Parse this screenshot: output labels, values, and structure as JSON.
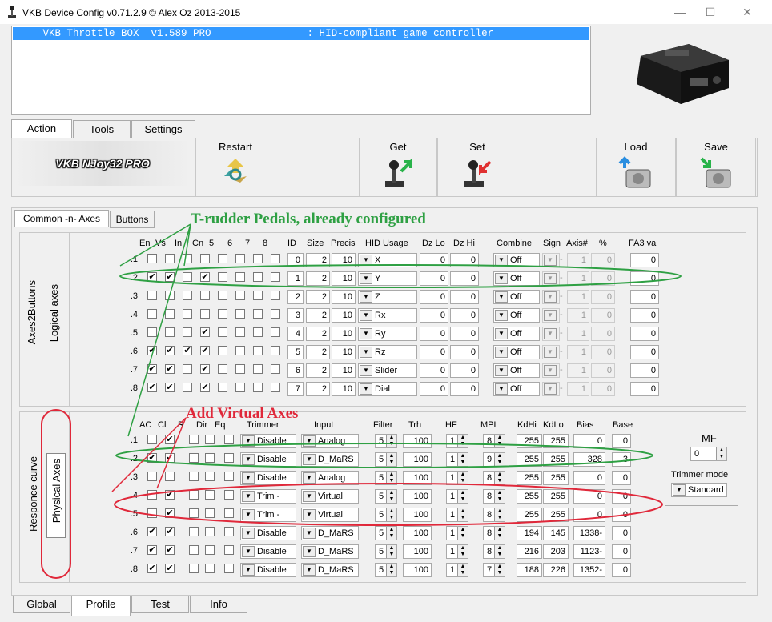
{
  "window": {
    "title": "VKB Device Config v0.71.2.9 © Alex Oz 2013-2015",
    "minimize": "—",
    "maximize": "☐",
    "close": "✕"
  },
  "device_list": {
    "row": "     VKB Throttle BOX  v1.589 PRO                : HID-compliant game controller"
  },
  "main_tabs": [
    "Action",
    "Tools",
    "Settings"
  ],
  "toolbar": {
    "brand": "VKB NJoy32 PRO",
    "restart": "Restart",
    "get": "Get",
    "set": "Set",
    "load": "Load",
    "save": "Save"
  },
  "sub_tabs": [
    "Common -n- Axes",
    "Buttons"
  ],
  "upper": {
    "side_outer": "Axes2Buttons",
    "side_inner": "Logical axes",
    "headers": [
      "En",
      "Vs",
      "In",
      "Cn",
      "5",
      "6",
      "7",
      "8",
      "ID",
      "Size",
      "Precis",
      "HID Usage",
      "Dz Lo",
      "Dz Hi",
      "Combine",
      "Sign",
      "Axis#",
      "%",
      "FA3 val"
    ],
    "rows": [
      {
        "n": ".1",
        "checks": [
          0,
          0,
          0,
          0,
          0,
          0,
          0,
          0
        ],
        "id": "0",
        "size": "2",
        "precis": "10",
        "hid": "X",
        "dzlo": "0",
        "dzhi": "0",
        "combine": "Off",
        "sign": "-",
        "axis": "1",
        "pct": "0",
        "fa3": "0"
      },
      {
        "n": ".2",
        "checks": [
          1,
          1,
          0,
          1,
          0,
          0,
          0,
          0
        ],
        "id": "1",
        "size": "2",
        "precis": "10",
        "hid": "Y",
        "dzlo": "0",
        "dzhi": "0",
        "combine": "Off",
        "sign": "-",
        "axis": "1",
        "pct": "0",
        "fa3": "0"
      },
      {
        "n": ".3",
        "checks": [
          0,
          0,
          0,
          0,
          0,
          0,
          0,
          0
        ],
        "id": "2",
        "size": "2",
        "precis": "10",
        "hid": "Z",
        "dzlo": "0",
        "dzhi": "0",
        "combine": "Off",
        "sign": "-",
        "axis": "1",
        "pct": "0",
        "fa3": "0"
      },
      {
        "n": ".4",
        "checks": [
          0,
          0,
          0,
          0,
          0,
          0,
          0,
          0
        ],
        "id": "3",
        "size": "2",
        "precis": "10",
        "hid": "Rx",
        "dzlo": "0",
        "dzhi": "0",
        "combine": "Off",
        "sign": "-",
        "axis": "1",
        "pct": "0",
        "fa3": "0"
      },
      {
        "n": ".5",
        "checks": [
          0,
          0,
          0,
          1,
          0,
          0,
          0,
          0
        ],
        "id": "4",
        "size": "2",
        "precis": "10",
        "hid": "Ry",
        "dzlo": "0",
        "dzhi": "0",
        "combine": "Off",
        "sign": "-",
        "axis": "1",
        "pct": "0",
        "fa3": "0"
      },
      {
        "n": ".6",
        "checks": [
          1,
          1,
          1,
          1,
          0,
          0,
          0,
          0
        ],
        "id": "5",
        "size": "2",
        "precis": "10",
        "hid": "Rz",
        "dzlo": "0",
        "dzhi": "0",
        "combine": "Off",
        "sign": "-",
        "axis": "1",
        "pct": "0",
        "fa3": "0"
      },
      {
        "n": ".7",
        "checks": [
          1,
          1,
          0,
          1,
          0,
          0,
          0,
          0
        ],
        "id": "6",
        "size": "2",
        "precis": "10",
        "hid": "Slider",
        "dzlo": "0",
        "dzhi": "0",
        "combine": "Off",
        "sign": "-",
        "axis": "1",
        "pct": "0",
        "fa3": "0"
      },
      {
        "n": ".8",
        "checks": [
          1,
          1,
          0,
          1,
          0,
          0,
          0,
          0
        ],
        "id": "7",
        "size": "2",
        "precis": "10",
        "hid": "Dial",
        "dzlo": "0",
        "dzhi": "0",
        "combine": "Off",
        "sign": "-",
        "axis": "1",
        "pct": "0",
        "fa3": "0"
      }
    ]
  },
  "lower": {
    "side_outer": "Responce curve",
    "side_inner": "Physical Axes",
    "headers": [
      "AC",
      "Cl",
      "R",
      "Dir",
      "Eq",
      "Trimmer",
      "Input",
      "Filter",
      "Trh",
      "HF",
      "MPL",
      "KdHi",
      "KdLo",
      "Bias",
      "Base"
    ],
    "rows": [
      {
        "n": ".1",
        "checks": [
          0,
          1,
          0,
          0,
          0
        ],
        "trimmer": "Disable",
        "input": "Analog",
        "filter": "5",
        "trh": "100",
        "hf": "1",
        "mpl": "8",
        "kdhi": "255",
        "kdlo": "255",
        "bias": "0",
        "base": "0"
      },
      {
        "n": ".2",
        "checks": [
          1,
          1,
          0,
          0,
          0
        ],
        "trimmer": "Disable",
        "input": "D_MaRS",
        "filter": "5",
        "trh": "100",
        "hf": "1",
        "mpl": "9",
        "kdhi": "255",
        "kdlo": "255",
        "bias": "328",
        "base": "3"
      },
      {
        "n": ".3",
        "checks": [
          0,
          0,
          0,
          0,
          0
        ],
        "trimmer": "Disable",
        "input": "Analog",
        "filter": "5",
        "trh": "100",
        "hf": "1",
        "mpl": "8",
        "kdhi": "255",
        "kdlo": "255",
        "bias": "0",
        "base": "0"
      },
      {
        "n": ".4",
        "checks": [
          0,
          1,
          0,
          0,
          0
        ],
        "trimmer": "Trim -",
        "input": "Virtual",
        "filter": "5",
        "trh": "100",
        "hf": "1",
        "mpl": "8",
        "kdhi": "255",
        "kdlo": "255",
        "bias": "0",
        "base": "0"
      },
      {
        "n": ".5",
        "checks": [
          0,
          1,
          0,
          0,
          0
        ],
        "trimmer": "Trim -",
        "input": "Virtual",
        "filter": "5",
        "trh": "100",
        "hf": "1",
        "mpl": "8",
        "kdhi": "255",
        "kdlo": "255",
        "bias": "0",
        "base": "0"
      },
      {
        "n": ".6",
        "checks": [
          1,
          1,
          0,
          0,
          0
        ],
        "trimmer": "Disable",
        "input": "D_MaRS",
        "filter": "5",
        "trh": "100",
        "hf": "1",
        "mpl": "8",
        "kdhi": "194",
        "kdlo": "145",
        "bias": "1338-",
        "base": "0"
      },
      {
        "n": ".7",
        "checks": [
          1,
          1,
          0,
          0,
          0
        ],
        "trimmer": "Disable",
        "input": "D_MaRS",
        "filter": "5",
        "trh": "100",
        "hf": "1",
        "mpl": "8",
        "kdhi": "216",
        "kdlo": "203",
        "bias": "1123-",
        "base": "0"
      },
      {
        "n": ".8",
        "checks": [
          1,
          1,
          0,
          0,
          0
        ],
        "trimmer": "Disable",
        "input": "D_MaRS",
        "filter": "5",
        "trh": "100",
        "hf": "1",
        "mpl": "7",
        "kdhi": "188",
        "kdlo": "226",
        "bias": "1352-",
        "base": "0"
      }
    ],
    "mf_label": "MF",
    "mf_value": "0",
    "trimmer_mode_label": "Trimmer mode",
    "trimmer_mode_value": "Standard"
  },
  "annotations": {
    "green": "T-rudder Pedals, already configured",
    "red": "Add Virtual Axes",
    "green_color": "#2ea043",
    "red_color": "#e0283a"
  },
  "bottom_tabs": [
    "Global",
    "Profile",
    "Test",
    "Info"
  ]
}
